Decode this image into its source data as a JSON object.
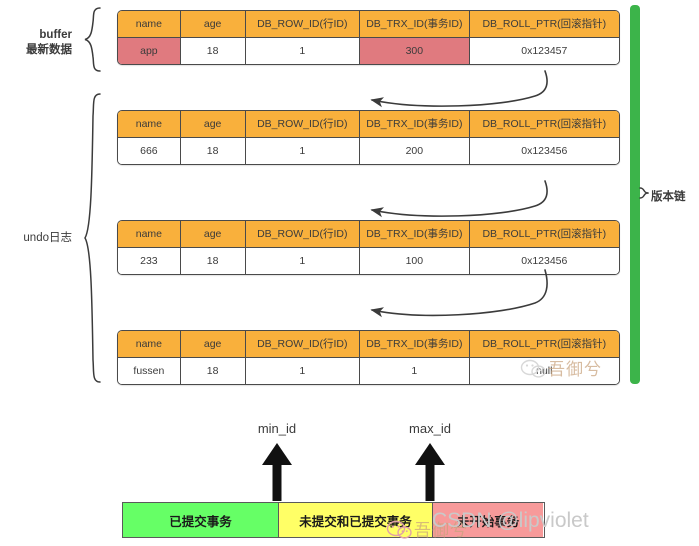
{
  "colors": {
    "header_orange": "#f9b03c",
    "highlight_red": "#e07a7f",
    "chain_green": "#3cb44a",
    "committed_green": "#66ff66",
    "mixed_yellow": "#ffff66",
    "not_started_pink": "#f79a9a",
    "stroke": "#4a4a4a"
  },
  "labels": {
    "buffer": "buffer\n最新数据",
    "undo": "undo日志",
    "version_chain": "版本链"
  },
  "columns": [
    "name",
    "age",
    "DB_ROW_ID(行ID)",
    "DB_TRX_ID(事务ID)",
    "DB_ROLL_PTR(回滚指针)"
  ],
  "records": [
    {
      "id": "buffer-record",
      "values": [
        "app",
        "18",
        "1",
        "300",
        "0x123457"
      ],
      "highlight": [
        0,
        3
      ]
    },
    {
      "id": "undo-record-1",
      "values": [
        "666",
        "18",
        "1",
        "200",
        "0x123456"
      ],
      "highlight": []
    },
    {
      "id": "undo-record-2",
      "values": [
        "233",
        "18",
        "1",
        "100",
        "0x123456"
      ],
      "highlight": []
    },
    {
      "id": "undo-record-3",
      "values": [
        "fussen",
        "18",
        "1",
        "1",
        "null"
      ],
      "highlight": []
    }
  ],
  "transaction_bar": {
    "markers": [
      {
        "name": "min_id",
        "label": "min_id"
      },
      {
        "name": "max_id",
        "label": "max_id"
      }
    ],
    "segments": [
      {
        "label": "已提交事务",
        "color": "#66ff66"
      },
      {
        "label": "未提交和已提交事务",
        "color": "#ffff66"
      },
      {
        "label": "未开始事务",
        "color": "#f79a9a"
      }
    ]
  },
  "watermarks": {
    "csdn": "CSDN @lipviolet",
    "wechat_name": "吾御兮"
  }
}
